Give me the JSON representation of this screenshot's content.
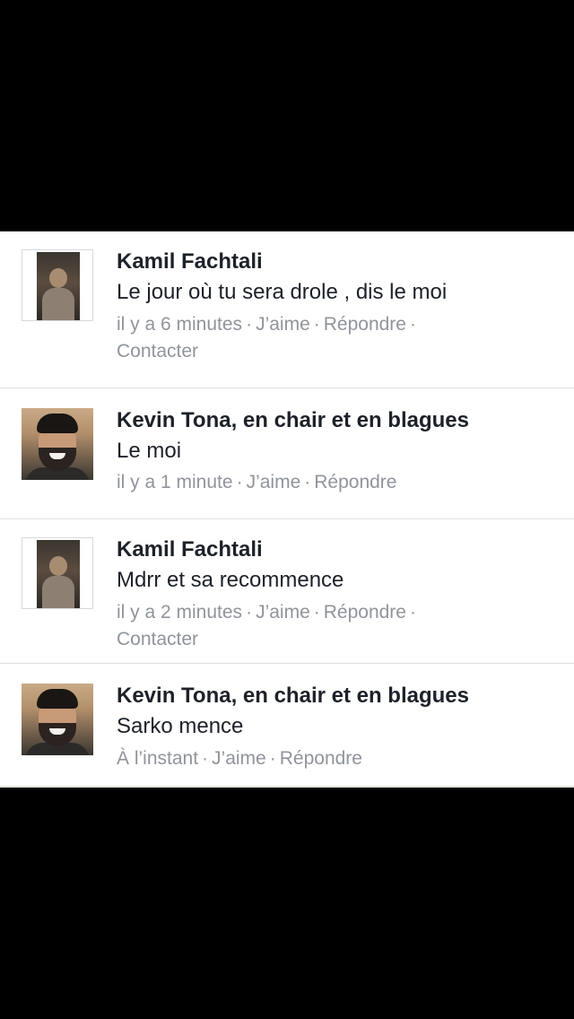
{
  "comments": [
    {
      "author": "Kamil Fachtali",
      "avatar": "kamil-avatar",
      "text": "Le jour où tu sera drole , dis le moi",
      "time": "il y a 6 minutes",
      "like": "J’aime",
      "reply": "Répondre",
      "contact": "Contacter"
    },
    {
      "author": "Kevin Tona, en chair et en blagues",
      "avatar": "kevin-avatar",
      "text": "Le moi",
      "time": "il y a 1 minute",
      "like": "J’aime",
      "reply": "Répondre"
    },
    {
      "author": "Kamil Fachtali",
      "avatar": "kamil-avatar",
      "text": "Mdrr et sa recommence",
      "time": "il y a 2 minutes",
      "like": "J’aime",
      "reply": "Répondre",
      "contact": "Contacter"
    },
    {
      "author": "Kevin Tona, en chair et en blagues",
      "avatar": "kevin-avatar",
      "text": "Sarko mence",
      "time": "À l’instant",
      "like": "J’aime",
      "reply": "Répondre"
    }
  ],
  "separator": "·",
  "colors": {
    "background": "#000000",
    "panel": "#ffffff",
    "author": "#1d2129",
    "meta": "#90949c",
    "divider": "#dddfe2"
  }
}
